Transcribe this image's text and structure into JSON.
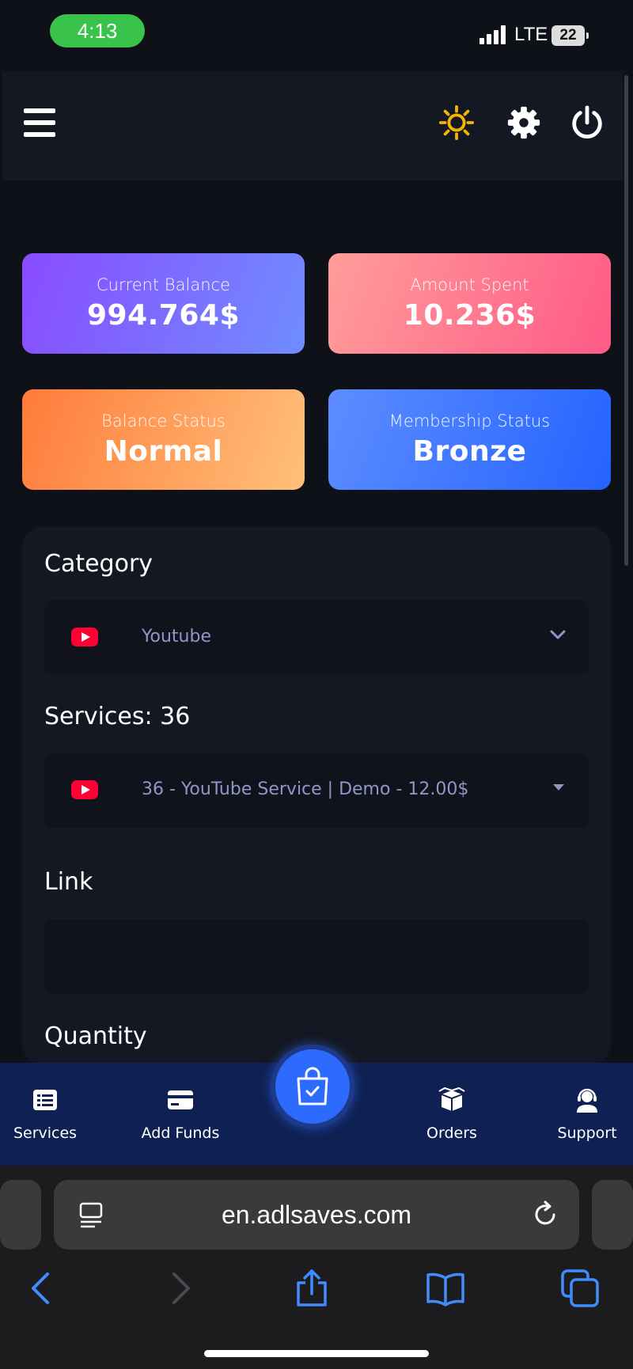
{
  "status_bar": {
    "time": "4:13",
    "network": "LTE",
    "battery": "22"
  },
  "header": {
    "menu_icon": "hamburger-icon",
    "theme_icon": "sun-icon",
    "settings_icon": "gear-icon",
    "logout_icon": "power-icon",
    "theme_color": "#f5b400"
  },
  "stats": [
    {
      "label": "Current Balance",
      "value": "994.764$"
    },
    {
      "label": "Amount Spent",
      "value": "10.236$"
    },
    {
      "label": "Balance Status",
      "value": "Normal"
    },
    {
      "label": "Membership Status",
      "value": "Bronze"
    }
  ],
  "form": {
    "category_label": "Category",
    "category_value": "Youtube",
    "services_label": "Services: 36",
    "service_value": "36 - YouTube Service | Demo - 12.00$",
    "link_label": "Link",
    "link_value": "",
    "quantity_label": "Quantity"
  },
  "bottom_nav": {
    "items": [
      {
        "label": "Services",
        "icon": "list-icon"
      },
      {
        "label": "Add Funds",
        "icon": "card-icon"
      },
      {
        "label": "Orders",
        "icon": "box-icon"
      },
      {
        "label": "Support",
        "icon": "headset-icon"
      }
    ],
    "fab_icon": "shopping-bag-check-icon"
  },
  "browser": {
    "url": "en.adlsaves.com",
    "accent": "#3f8cff"
  }
}
